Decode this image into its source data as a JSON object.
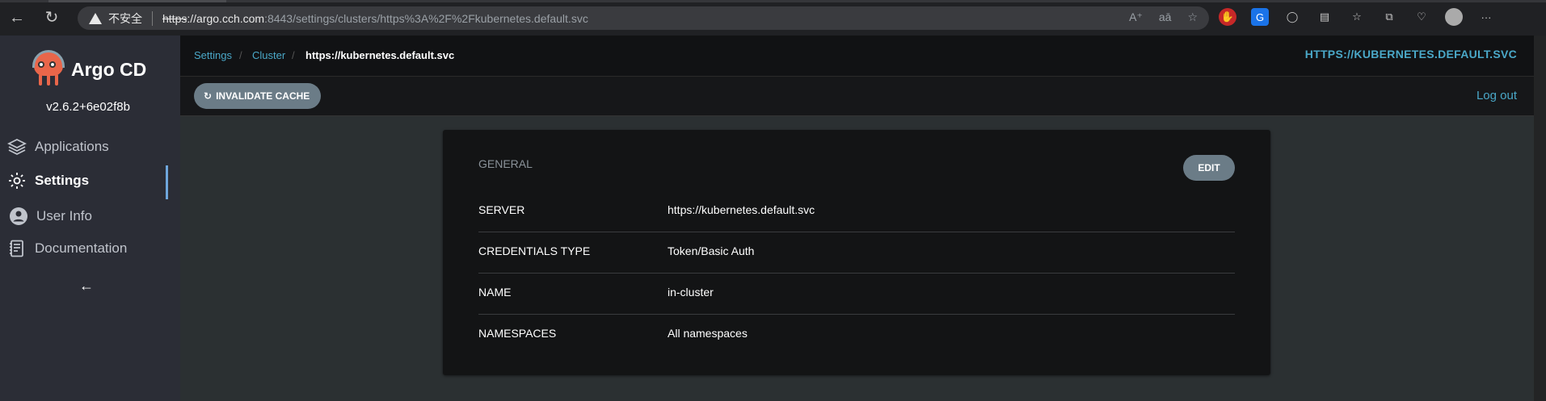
{
  "browser": {
    "security_label": "不安全",
    "url_scheme": "https",
    "url_host": "://argo.cch.com",
    "url_rest": ":8443/settings/clusters/https%3A%2F%2Fkubernetes.default.svc"
  },
  "sidebar": {
    "brand": "Argo CD",
    "version": "v2.6.2+6e02f8b",
    "items": [
      {
        "label": "Applications",
        "icon": "layers-icon"
      },
      {
        "label": "Settings",
        "icon": "gear-icon"
      },
      {
        "label": "User Info",
        "icon": "user-icon"
      },
      {
        "label": "Documentation",
        "icon": "book-icon"
      }
    ],
    "active_item": "Settings"
  },
  "breadcrumb": [
    "Settings",
    "Cluster",
    "https://kubernetes.default.svc"
  ],
  "page_title": "HTTPS://KUBERNETES.DEFAULT.SVC",
  "toolbar": {
    "invalidate_label": "INVALIDATE CACHE",
    "logout_label": "Log out"
  },
  "card": {
    "title": "GENERAL",
    "edit_label": "EDIT",
    "rows": [
      {
        "key": "SERVER",
        "value": "https://kubernetes.default.svc"
      },
      {
        "key": "CREDENTIALS TYPE",
        "value": "Token/Basic Auth"
      },
      {
        "key": "NAME",
        "value": "in-cluster"
      },
      {
        "key": "NAMESPACES",
        "value": "All namespaces"
      }
    ]
  },
  "colors": {
    "accent": "#4aa8c8",
    "button": "#6b7c87",
    "sidebar": "#2b2d36",
    "active_indicator": "#6fa7dd"
  }
}
